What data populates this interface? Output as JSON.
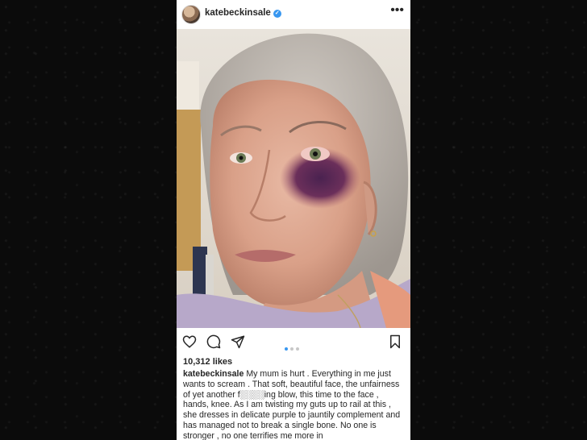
{
  "post": {
    "username": "katebeckinsale",
    "verified_symbol": "✓",
    "more_symbol": "•••",
    "likes": "10,312 likes",
    "caption_user": "katebeckinsale",
    "caption_text": "My mum is hurt . Everything in me just wants to scream . That soft, beautiful face, the unfairness of yet another f░░░░ing blow, this time to the face , hands, knee. As I am twisting my guts up to rail at this , she dresses in delicate purple to jauntily complement and has managed not to break a single bone. No one is stronger , no one terrifies me more in",
    "carousel": {
      "total": 3,
      "active_index": 0
    },
    "icons": {
      "like": "heart-icon",
      "comment": "comment-icon",
      "share": "send-icon",
      "save": "bookmark-icon",
      "more": "more-options-icon"
    },
    "colors": {
      "accent": "#3897f0",
      "text": "#262626",
      "background": "#0b0b0b"
    }
  }
}
